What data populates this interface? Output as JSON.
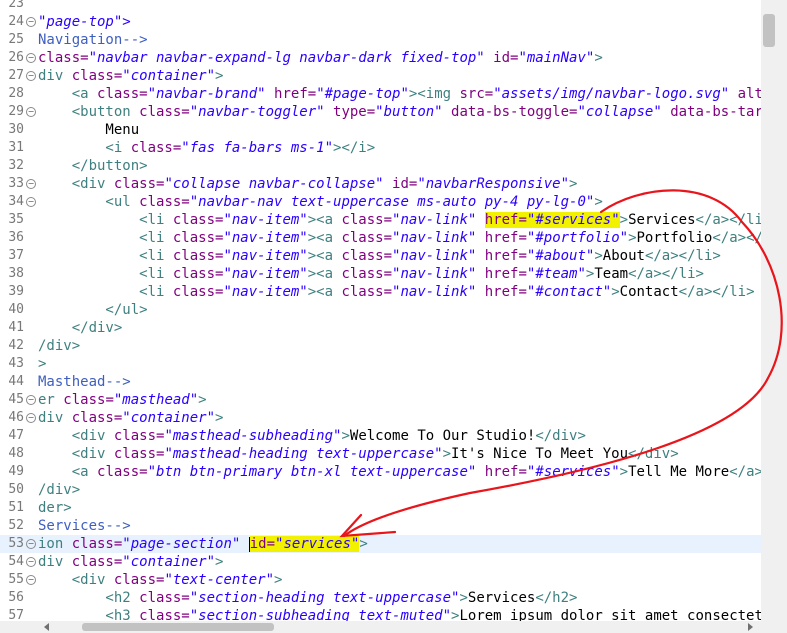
{
  "editor": {
    "current_line": 53,
    "lines": [
      {
        "n": "23",
        "fold": false,
        "segs": []
      },
      {
        "n": "24",
        "fold": true,
        "segs": [
          {
            "t": "\"page-top\">",
            "c": "val"
          }
        ]
      },
      {
        "n": "25",
        "fold": false,
        "segs": [
          {
            "t": "Navigation-->",
            "c": "com"
          }
        ]
      },
      {
        "n": "26",
        "fold": true,
        "segs": [
          {
            "t": "class=",
            "c": "attr"
          },
          {
            "t": "\"navbar navbar-expand-lg navbar-dark fixed-top\"",
            "c": "val"
          },
          {
            "t": " id=",
            "c": "attr"
          },
          {
            "t": "\"mainNav\"",
            "c": "val"
          },
          {
            "t": ">",
            "c": "tag"
          }
        ]
      },
      {
        "n": "27",
        "fold": true,
        "segs": [
          {
            "t": "div ",
            "c": "tag"
          },
          {
            "t": "class=",
            "c": "attr"
          },
          {
            "t": "\"container\"",
            "c": "val"
          },
          {
            "t": ">",
            "c": "tag"
          }
        ]
      },
      {
        "n": "28",
        "fold": false,
        "segs": [
          {
            "t": "    <a ",
            "c": "tag"
          },
          {
            "t": "class=",
            "c": "attr"
          },
          {
            "t": "\"navbar-brand\"",
            "c": "val"
          },
          {
            "t": " href=",
            "c": "attr"
          },
          {
            "t": "\"#page-top\"",
            "c": "val"
          },
          {
            "t": "><img ",
            "c": "tag"
          },
          {
            "t": "src=",
            "c": "attr"
          },
          {
            "t": "\"assets/img/navbar-logo.svg\"",
            "c": "val"
          },
          {
            "t": " alt=",
            "c": "attr"
          },
          {
            "t": "\"...",
            "c": "val"
          }
        ]
      },
      {
        "n": "29",
        "fold": true,
        "segs": [
          {
            "t": "    <button ",
            "c": "tag"
          },
          {
            "t": "class=",
            "c": "attr"
          },
          {
            "t": "\"navbar-toggler\"",
            "c": "val"
          },
          {
            "t": " type=",
            "c": "attr"
          },
          {
            "t": "\"button\"",
            "c": "val"
          },
          {
            "t": " data-bs-toggle=",
            "c": "attr"
          },
          {
            "t": "\"collapse\"",
            "c": "val"
          },
          {
            "t": " data-bs-target=",
            "c": "attr"
          },
          {
            "t": "\"",
            "c": "val"
          }
        ]
      },
      {
        "n": "30",
        "fold": false,
        "segs": [
          {
            "t": "        Menu",
            "c": "txt"
          }
        ]
      },
      {
        "n": "31",
        "fold": false,
        "segs": [
          {
            "t": "        <i ",
            "c": "tag"
          },
          {
            "t": "class=",
            "c": "attr"
          },
          {
            "t": "\"fas fa-bars ms-1\"",
            "c": "val"
          },
          {
            "t": "></i>",
            "c": "tag"
          }
        ]
      },
      {
        "n": "32",
        "fold": false,
        "segs": [
          {
            "t": "    </button>",
            "c": "tag"
          }
        ]
      },
      {
        "n": "33",
        "fold": true,
        "segs": [
          {
            "t": "    <div ",
            "c": "tag"
          },
          {
            "t": "class=",
            "c": "attr"
          },
          {
            "t": "\"collapse navbar-collapse\"",
            "c": "val"
          },
          {
            "t": " id=",
            "c": "attr"
          },
          {
            "t": "\"navbarResponsive\"",
            "c": "val"
          },
          {
            "t": ">",
            "c": "tag"
          }
        ]
      },
      {
        "n": "34",
        "fold": true,
        "segs": [
          {
            "t": "        <ul ",
            "c": "tag"
          },
          {
            "t": "class=",
            "c": "attr"
          },
          {
            "t": "\"navbar-nav text-uppercase ms-auto py-4 py-lg-0\"",
            "c": "val"
          },
          {
            "t": ">",
            "c": "tag"
          }
        ]
      },
      {
        "n": "35",
        "fold": false,
        "segs": [
          {
            "t": "            <li ",
            "c": "tag"
          },
          {
            "t": "class=",
            "c": "attr"
          },
          {
            "t": "\"nav-item\"",
            "c": "val"
          },
          {
            "t": "><a ",
            "c": "tag"
          },
          {
            "t": "class=",
            "c": "attr"
          },
          {
            "t": "\"nav-link\"",
            "c": "val"
          },
          {
            "t": " ",
            "c": "txt"
          },
          {
            "t": "href=",
            "c": "attr",
            "hl": true
          },
          {
            "t": "\"#services\"",
            "c": "val",
            "hl": true
          },
          {
            "t": ">",
            "c": "tag"
          },
          {
            "t": "Services",
            "c": "txt"
          },
          {
            "t": "</a></li>",
            "c": "tag"
          }
        ]
      },
      {
        "n": "36",
        "fold": false,
        "segs": [
          {
            "t": "            <li ",
            "c": "tag"
          },
          {
            "t": "class=",
            "c": "attr"
          },
          {
            "t": "\"nav-item\"",
            "c": "val"
          },
          {
            "t": "><a ",
            "c": "tag"
          },
          {
            "t": "class=",
            "c": "attr"
          },
          {
            "t": "\"nav-link\"",
            "c": "val"
          },
          {
            "t": " href=",
            "c": "attr"
          },
          {
            "t": "\"#portfolio\"",
            "c": "val"
          },
          {
            "t": ">",
            "c": "tag"
          },
          {
            "t": "Portfolio",
            "c": "txt"
          },
          {
            "t": "</a></li>",
            "c": "tag"
          }
        ]
      },
      {
        "n": "37",
        "fold": false,
        "segs": [
          {
            "t": "            <li ",
            "c": "tag"
          },
          {
            "t": "class=",
            "c": "attr"
          },
          {
            "t": "\"nav-item\"",
            "c": "val"
          },
          {
            "t": "><a ",
            "c": "tag"
          },
          {
            "t": "class=",
            "c": "attr"
          },
          {
            "t": "\"nav-link\"",
            "c": "val"
          },
          {
            "t": " href=",
            "c": "attr"
          },
          {
            "t": "\"#about\"",
            "c": "val"
          },
          {
            "t": ">",
            "c": "tag"
          },
          {
            "t": "About",
            "c": "txt"
          },
          {
            "t": "</a></li>",
            "c": "tag"
          }
        ]
      },
      {
        "n": "38",
        "fold": false,
        "segs": [
          {
            "t": "            <li ",
            "c": "tag"
          },
          {
            "t": "class=",
            "c": "attr"
          },
          {
            "t": "\"nav-item\"",
            "c": "val"
          },
          {
            "t": "><a ",
            "c": "tag"
          },
          {
            "t": "class=",
            "c": "attr"
          },
          {
            "t": "\"nav-link\"",
            "c": "val"
          },
          {
            "t": " href=",
            "c": "attr"
          },
          {
            "t": "\"#team\"",
            "c": "val"
          },
          {
            "t": ">",
            "c": "tag"
          },
          {
            "t": "Team",
            "c": "txt"
          },
          {
            "t": "</a></li>",
            "c": "tag"
          }
        ]
      },
      {
        "n": "39",
        "fold": false,
        "segs": [
          {
            "t": "            <li ",
            "c": "tag"
          },
          {
            "t": "class=",
            "c": "attr"
          },
          {
            "t": "\"nav-item\"",
            "c": "val"
          },
          {
            "t": "><a ",
            "c": "tag"
          },
          {
            "t": "class=",
            "c": "attr"
          },
          {
            "t": "\"nav-link\"",
            "c": "val"
          },
          {
            "t": " href=",
            "c": "attr"
          },
          {
            "t": "\"#contact\"",
            "c": "val"
          },
          {
            "t": ">",
            "c": "tag"
          },
          {
            "t": "Contact",
            "c": "txt"
          },
          {
            "t": "</a></li>",
            "c": "tag"
          }
        ]
      },
      {
        "n": "40",
        "fold": false,
        "segs": [
          {
            "t": "        </ul>",
            "c": "tag"
          }
        ]
      },
      {
        "n": "41",
        "fold": false,
        "segs": [
          {
            "t": "    </div>",
            "c": "tag"
          }
        ]
      },
      {
        "n": "42",
        "fold": false,
        "segs": [
          {
            "t": "/div>",
            "c": "tag"
          }
        ]
      },
      {
        "n": "43",
        "fold": false,
        "segs": [
          {
            "t": ">",
            "c": "tag"
          }
        ]
      },
      {
        "n": "44",
        "fold": false,
        "segs": [
          {
            "t": "Masthead-->",
            "c": "com"
          }
        ]
      },
      {
        "n": "45",
        "fold": true,
        "segs": [
          {
            "t": "er ",
            "c": "tag"
          },
          {
            "t": "class=",
            "c": "attr"
          },
          {
            "t": "\"masthead\"",
            "c": "val"
          },
          {
            "t": ">",
            "c": "tag"
          }
        ]
      },
      {
        "n": "46",
        "fold": true,
        "segs": [
          {
            "t": "div ",
            "c": "tag"
          },
          {
            "t": "class=",
            "c": "attr"
          },
          {
            "t": "\"container\"",
            "c": "val"
          },
          {
            "t": ">",
            "c": "tag"
          }
        ]
      },
      {
        "n": "47",
        "fold": false,
        "segs": [
          {
            "t": "    <div ",
            "c": "tag"
          },
          {
            "t": "class=",
            "c": "attr"
          },
          {
            "t": "\"masthead-subheading\"",
            "c": "val"
          },
          {
            "t": ">",
            "c": "tag"
          },
          {
            "t": "Welcome To Our Studio!",
            "c": "txt"
          },
          {
            "t": "</div>",
            "c": "tag"
          }
        ]
      },
      {
        "n": "48",
        "fold": false,
        "segs": [
          {
            "t": "    <div ",
            "c": "tag"
          },
          {
            "t": "class=",
            "c": "attr"
          },
          {
            "t": "\"masthead-heading text-uppercase\"",
            "c": "val"
          },
          {
            "t": ">",
            "c": "tag"
          },
          {
            "t": "It's Nice To Meet You",
            "c": "txt"
          },
          {
            "t": "</div>",
            "c": "tag"
          }
        ]
      },
      {
        "n": "49",
        "fold": false,
        "segs": [
          {
            "t": "    <a ",
            "c": "tag"
          },
          {
            "t": "class=",
            "c": "attr"
          },
          {
            "t": "\"btn btn-primary btn-xl text-uppercase\"",
            "c": "val"
          },
          {
            "t": " href=",
            "c": "attr"
          },
          {
            "t": "\"#services\"",
            "c": "val"
          },
          {
            "t": ">",
            "c": "tag"
          },
          {
            "t": "Tell Me More",
            "c": "txt"
          },
          {
            "t": "</a>",
            "c": "tag"
          }
        ]
      },
      {
        "n": "50",
        "fold": false,
        "segs": [
          {
            "t": "/div>",
            "c": "tag"
          }
        ]
      },
      {
        "n": "51",
        "fold": false,
        "segs": [
          {
            "t": "der>",
            "c": "tag"
          }
        ]
      },
      {
        "n": "52",
        "fold": false,
        "segs": [
          {
            "t": "Services-->",
            "c": "com"
          }
        ]
      },
      {
        "n": "53",
        "fold": true,
        "segs": [
          {
            "t": "ion ",
            "c": "tag"
          },
          {
            "t": "class=",
            "c": "attr"
          },
          {
            "t": "\"page-section\"",
            "c": "val"
          },
          {
            "t": " ",
            "c": "txt"
          },
          {
            "caret": true
          },
          {
            "t": "id=",
            "c": "attr",
            "hl": true
          },
          {
            "t": "\"services\"",
            "c": "val",
            "hl": true
          },
          {
            "t": ">",
            "c": "tag"
          }
        ]
      },
      {
        "n": "54",
        "fold": true,
        "segs": [
          {
            "t": "div ",
            "c": "tag"
          },
          {
            "t": "class=",
            "c": "attr"
          },
          {
            "t": "\"container\"",
            "c": "val"
          },
          {
            "t": ">",
            "c": "tag"
          }
        ]
      },
      {
        "n": "55",
        "fold": true,
        "segs": [
          {
            "t": "    <div ",
            "c": "tag"
          },
          {
            "t": "class=",
            "c": "attr"
          },
          {
            "t": "\"text-center\"",
            "c": "val"
          },
          {
            "t": ">",
            "c": "tag"
          }
        ]
      },
      {
        "n": "56",
        "fold": false,
        "segs": [
          {
            "t": "        <h2 ",
            "c": "tag"
          },
          {
            "t": "class=",
            "c": "attr"
          },
          {
            "t": "\"section-heading text-uppercase\"",
            "c": "val"
          },
          {
            "t": ">",
            "c": "tag"
          },
          {
            "t": "Services",
            "c": "txt"
          },
          {
            "t": "</h2>",
            "c": "tag"
          }
        ]
      },
      {
        "n": "57",
        "fold": false,
        "segs": [
          {
            "t": "        <h3 ",
            "c": "tag"
          },
          {
            "t": "class=",
            "c": "attr"
          },
          {
            "t": "\"section-subheading text-muted\"",
            "c": "val"
          },
          {
            "t": ">",
            "c": "tag"
          },
          {
            "t": "Lorem ipsum dolor sit amet consectetur.",
            "c": "txt"
          },
          {
            "t": "</",
            "c": "tag"
          }
        ]
      }
    ]
  },
  "annotation": {
    "stroke_color": "#e8151b"
  },
  "colors": {
    "tag": "#3f7f7f",
    "attr": "#7f007f",
    "value": "#2a00ff",
    "comment": "#3f5fbf",
    "highlight": "#f2f200",
    "current_line": "#e8f2fe"
  }
}
